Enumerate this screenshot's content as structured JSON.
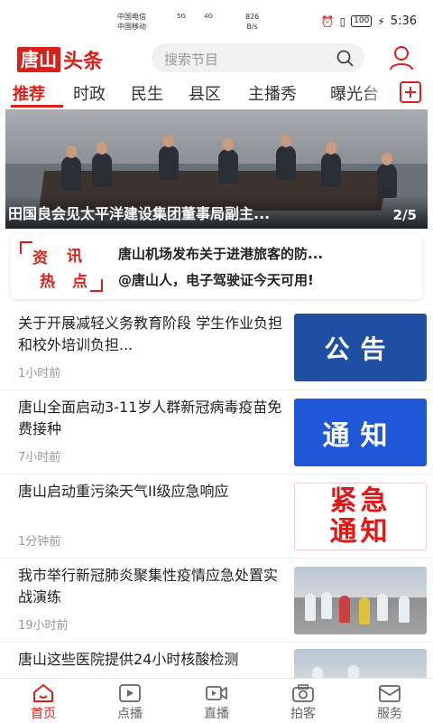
{
  "status_bar": {
    "carrier_1": "中国电信",
    "carrier_2": "中国移动",
    "network_1": "5G",
    "network_2": "4G",
    "speed_value": "826",
    "speed_unit": "B/s",
    "battery": "100",
    "time": "5:36"
  },
  "header": {
    "logo_box": "唐山",
    "logo_text": "头条",
    "search_placeholder": "搜索节目"
  },
  "tabs": [
    {
      "label": "推荐",
      "active": true
    },
    {
      "label": "时政",
      "active": false
    },
    {
      "label": "民生",
      "active": false
    },
    {
      "label": "县区",
      "active": false
    },
    {
      "label": "主播秀",
      "active": false
    },
    {
      "label": "曝光台",
      "active": false
    }
  ],
  "banner": {
    "title": "田国良会见太平洋建设集团董事局副主...",
    "page": "2/5"
  },
  "hot_news": {
    "badge_chars": [
      "资",
      "讯",
      "热",
      "点"
    ],
    "lines": [
      "唐山机场发布关于进港旅客的防...",
      "@唐山人，电子驾驶证今天可用!"
    ]
  },
  "feed": [
    {
      "title": "关于开展减轻义务教育阶段 学生作业负担和校外培训负担...",
      "time": "1小时前",
      "thumb_type": "blue",
      "thumb_text": "公告"
    },
    {
      "title": "唐山全面启动3-11岁人群新冠病毒疫苗免费接种",
      "time": "7小时前",
      "thumb_type": "blue2",
      "thumb_text": "通知"
    },
    {
      "title": "唐山启动重污染天气II级应急响应",
      "time": "1分钟前",
      "thumb_type": "red",
      "thumb_text_1": "紧急",
      "thumb_text_2": "通知"
    },
    {
      "title": "我市举行新冠肺炎聚集性疫情应急处置实战演练",
      "time": "19小时前",
      "thumb_type": "photo"
    },
    {
      "title": "唐山这些医院提供24小时核酸检测",
      "time": "",
      "thumb_type": "photo"
    }
  ],
  "bottom_nav": [
    {
      "label": "首页",
      "icon": "home-icon",
      "active": true
    },
    {
      "label": "点播",
      "icon": "play-icon",
      "active": false
    },
    {
      "label": "直播",
      "icon": "live-camera-icon",
      "active": false
    },
    {
      "label": "拍客",
      "icon": "camera-icon",
      "active": false
    },
    {
      "label": "服务",
      "icon": "mail-icon",
      "active": false
    }
  ],
  "colors": {
    "brand_red": "#d9201a",
    "notice_blue": "#1f4fa3"
  }
}
